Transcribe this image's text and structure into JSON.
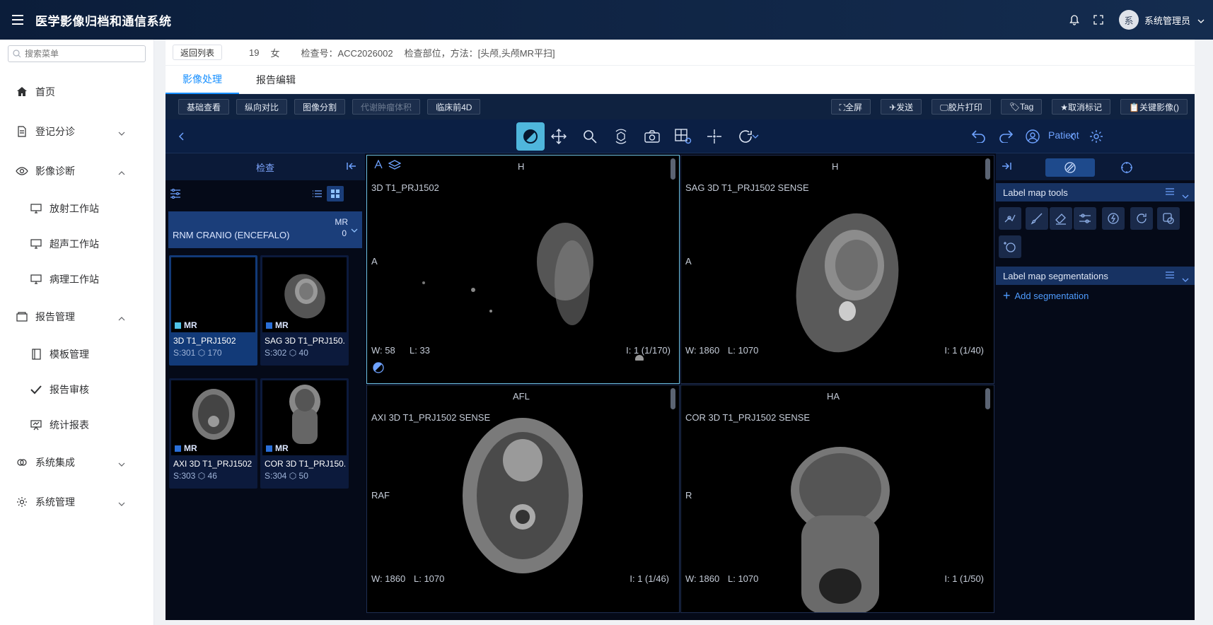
{
  "app": {
    "title": "医学影像归档和通信系统"
  },
  "user": {
    "avatar_text": "系",
    "name": "系统管理员"
  },
  "sidebar": {
    "search_placeholder": "搜索菜单",
    "items": [
      {
        "label": "首页"
      },
      {
        "label": "登记分诊"
      },
      {
        "label": "影像诊断"
      },
      {
        "label": "放射工作站"
      },
      {
        "label": "超声工作站"
      },
      {
        "label": "病理工作站"
      },
      {
        "label": "报告管理"
      },
      {
        "label": "模板管理"
      },
      {
        "label": "报告审核"
      },
      {
        "label": "统计报表"
      },
      {
        "label": "系统集成"
      },
      {
        "label": "系统管理"
      }
    ]
  },
  "patient": {
    "back_label": "返回列表",
    "age": "19",
    "sex": "女",
    "exam_no": "检查号：ACC2026002",
    "exam_part": "检查部位，方法：[头颅,头颅MR平扫]"
  },
  "tabs": [
    "影像处理",
    "报告编辑"
  ],
  "toolbar": {
    "left": [
      "基础查看",
      "纵向对比",
      "图像分割",
      "代谢肿瘤体积",
      "临床前4D"
    ],
    "right": [
      "⛶全屏",
      "✈发送",
      "🖵胶片打印",
      "🏷Tag",
      "★取消标记",
      "📋关键影像()"
    ]
  },
  "viewer_toolbar": {
    "patient_label": "Patient"
  },
  "study_panel": {
    "title": "检查",
    "group": {
      "description": "RNM CRANIO (ENCEFALO)",
      "modality": "MR",
      "count": "0"
    },
    "series": [
      {
        "modality": "MR",
        "name": "3D T1_PRJ1502",
        "series_no": "S:301",
        "images": "170",
        "color": "#4fc3e8"
      },
      {
        "modality": "MR",
        "name": "SAG 3D T1_PRJ150...",
        "series_no": "S:302",
        "images": "40",
        "color": "#2a6fd8"
      },
      {
        "modality": "MR",
        "name": "AXI 3D T1_PRJ1502 ...",
        "series_no": "S:303",
        "images": "46",
        "color": "#2a6fd8"
      },
      {
        "modality": "MR",
        "name": "COR 3D T1_PRJ150...",
        "series_no": "S:304",
        "images": "50",
        "color": "#2a6fd8"
      }
    ]
  },
  "viewports": [
    {
      "top": "H",
      "left": "A",
      "series": "3D T1_PRJ1502",
      "w": "W: 58",
      "l": "L: 33",
      "index": "I: 1 (1/170)"
    },
    {
      "top": "H",
      "left": "A",
      "series": "SAG 3D T1_PRJ1502 SENSE",
      "w": "W: 1860",
      "l": "L: 1070",
      "index": "I: 1 (1/40)"
    },
    {
      "top": "AFL",
      "left": "RAF",
      "series": "AXI 3D T1_PRJ1502 SENSE",
      "w": "W: 1860",
      "l": "L: 1070",
      "index": "I: 1 (1/46)"
    },
    {
      "top": "HA",
      "left": "R",
      "series": "COR 3D T1_PRJ1502 SENSE",
      "w": "W: 1860",
      "l": "L: 1070",
      "index": "I: 1 (1/50)"
    }
  ],
  "segmentation": {
    "tools_title": "Label map tools",
    "segs_title": "Label map segmentations",
    "add_label": "Add segmentation"
  }
}
